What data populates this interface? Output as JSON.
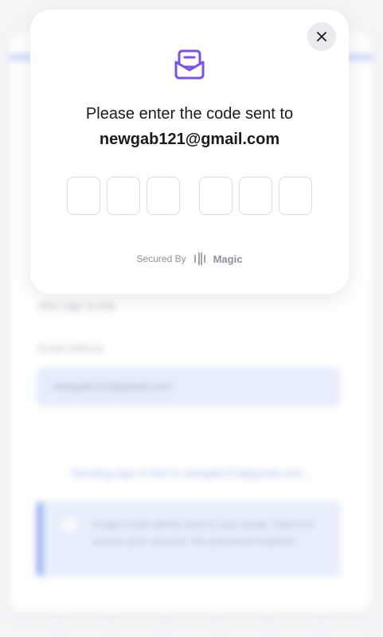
{
  "modal": {
    "title": "Please enter the code sent to",
    "email": "newgab121@gmail.com",
    "code_digits": [
      "",
      "",
      "",
      "",
      "",
      ""
    ],
    "footer": {
      "secured_by": "Secured By",
      "brand": "Magic"
    },
    "icons": {
      "close": "close-icon",
      "mail": "envelope-open-icon",
      "brand": "magic-logo-icon"
    },
    "accent_color": "#7b4ff0"
  },
  "background": {
    "text1": "Also sign in link",
    "field_label": "Email address",
    "field_value": "newgab121@gmail.com",
    "link": "Sending sign in link to newgab121@gmail.com...",
    "notice_icon": "info-icon",
    "notice": "A sign in link will be sent to your email. Click it to access your account. No password required."
  }
}
